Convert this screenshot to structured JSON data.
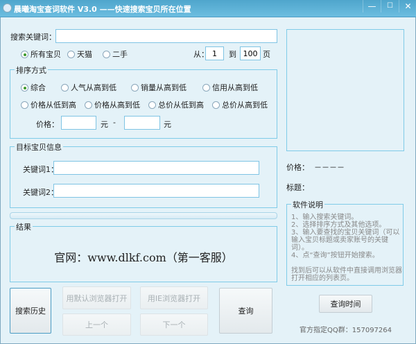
{
  "window": {
    "title": "晨曦淘宝查词软件 V3.0  ——快速搜索宝贝所在位置",
    "minimize": "—",
    "maximize": "☐",
    "close": "✕"
  },
  "search": {
    "label": "搜索关键词：",
    "value": "",
    "scope": [
      "所有宝贝",
      "天猫",
      "二手"
    ],
    "scope_selected": 0,
    "from_label": "从：",
    "from_value": "1",
    "to_label": "到",
    "to_value": "100",
    "page_label": "页"
  },
  "sort": {
    "title": "排序方式",
    "options": [
      "综合",
      "人气从高到低",
      "销量从高到低",
      "信用从高到低",
      "价格从低到高",
      "价格从高到低",
      "总价从低到高",
      "总价从高到低"
    ],
    "selected": 0,
    "price_label": "价格：",
    "price_min": "",
    "price_unit": "元",
    "price_sep": "-",
    "price_max": ""
  },
  "target": {
    "title": "目标宝贝信息",
    "kw1_label": "关键词1：",
    "kw1_value": "",
    "kw2_label": "关键词2：",
    "kw2_value": ""
  },
  "progress": 0,
  "result": {
    "title": "结果",
    "text": "官网：www.dlkf.com（第一客服）"
  },
  "buttons": {
    "history": "搜索历史",
    "open_default": "用默认浏览器打开",
    "open_ie": "用IE浏览器打开",
    "prev": "上一个",
    "next": "下一个",
    "query": "查询",
    "query_time": "查询时间"
  },
  "item": {
    "price_label": "价格：",
    "price_value": "－－－－",
    "title_label": "标题："
  },
  "notes": {
    "title": "软件说明",
    "text": "1、输入搜索关键词。\n2、选择排序方式及其他选项。\n3、输入要查找的宝贝关键词（可以输入宝贝标题或卖家账号的关键词）。\n4、点“查询”按钮开始搜索。\n\n找到后可以从软件中直接调用浏览器打开相应的列表页。"
  },
  "footer": {
    "qq": "官方指定QQ群：157097264"
  }
}
